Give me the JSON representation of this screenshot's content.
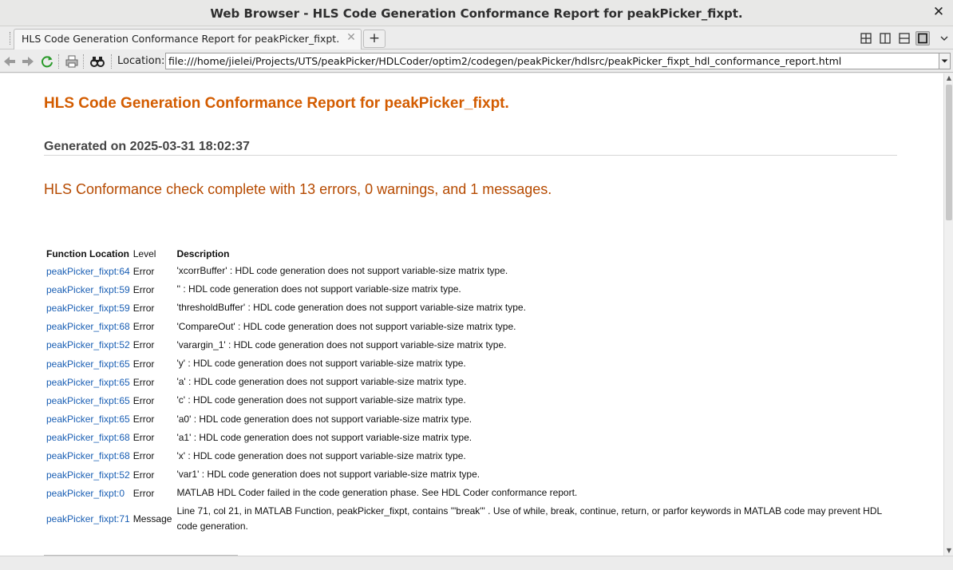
{
  "window": {
    "title": "Web Browser - HLS Code Generation Conformance Report for peakPicker_fixpt.",
    "close_glyph": "✕"
  },
  "tabs": {
    "active_label": "HLS Code Generation Conformance Report for peakPicker_fixpt.",
    "close_glyph": "✕",
    "new_tab_glyph": "+"
  },
  "toolbar": {
    "location_label": "Location:",
    "url": "file:///home/jielei/Projects/UTS/peakPicker/HDLCoder/optim2/codegen/peakPicker/hdlsrc/peakPicker_fixpt_hdl_conformance_report.html",
    "icons": [
      "back-icon",
      "forward-icon",
      "refresh-icon",
      "print-icon",
      "find-icon"
    ]
  },
  "report": {
    "title": "HLS Code Generation Conformance Report for peakPicker_fixpt.",
    "generated": "Generated on 2025-03-31 18:02:37",
    "summary": "HLS Conformance check complete with 13 errors, 0 warnings, and 1 messages.",
    "columns": [
      "Function Location",
      "Level",
      "Description"
    ],
    "rows": [
      {
        "location": "peakPicker_fixpt:64",
        "level": "Error",
        "description": "'xcorrBuffer' : HDL code generation does not support variable-size matrix type."
      },
      {
        "location": "peakPicker_fixpt:59",
        "level": "Error",
        "description": "'' : HDL code generation does not support variable-size matrix type."
      },
      {
        "location": "peakPicker_fixpt:59",
        "level": "Error",
        "description": "'thresholdBuffer' : HDL code generation does not support variable-size matrix type."
      },
      {
        "location": "peakPicker_fixpt:68",
        "level": "Error",
        "description": "'CompareOut' : HDL code generation does not support variable-size matrix type."
      },
      {
        "location": "peakPicker_fixpt:52",
        "level": "Error",
        "description": "'varargin_1' : HDL code generation does not support variable-size matrix type."
      },
      {
        "location": "peakPicker_fixpt:65",
        "level": "Error",
        "description": "'y' : HDL code generation does not support variable-size matrix type."
      },
      {
        "location": "peakPicker_fixpt:65",
        "level": "Error",
        "description": "'a' : HDL code generation does not support variable-size matrix type."
      },
      {
        "location": "peakPicker_fixpt:65",
        "level": "Error",
        "description": "'c' : HDL code generation does not support variable-size matrix type."
      },
      {
        "location": "peakPicker_fixpt:65",
        "level": "Error",
        "description": "'a0' : HDL code generation does not support variable-size matrix type."
      },
      {
        "location": "peakPicker_fixpt:68",
        "level": "Error",
        "description": "'a1' : HDL code generation does not support variable-size matrix type."
      },
      {
        "location": "peakPicker_fixpt:68",
        "level": "Error",
        "description": "'x' : HDL code generation does not support variable-size matrix type."
      },
      {
        "location": "peakPicker_fixpt:52",
        "level": "Error",
        "description": "'var1' : HDL code generation does not support variable-size matrix type."
      },
      {
        "location": "peakPicker_fixpt:0",
        "level": "Error",
        "description": "MATLAB HDL Coder failed in the code generation phase. See HDL Coder conformance report."
      },
      {
        "location": "peakPicker_fixpt:71",
        "level": "Message",
        "description": "Line 71, col 21, in MATLAB Function, peakPicker_fixpt, contains '\"break\"' . Use of while, break, continue, return, or parfor keywords in MATLAB code may prevent HDL code generation."
      }
    ]
  },
  "colors": {
    "title": "#d35c00",
    "summary": "#b64a00",
    "link": "#1a5fb4"
  }
}
